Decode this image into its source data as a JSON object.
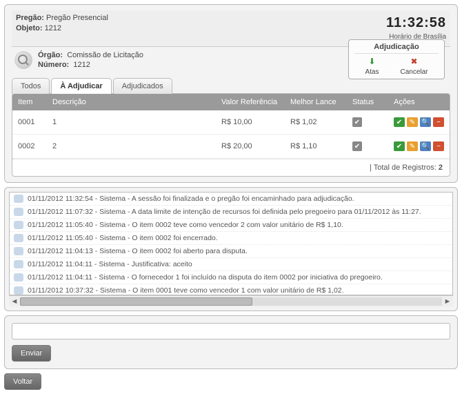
{
  "header": {
    "pregao_label": "Pregão:",
    "pregao_value": "Pregão Presencial",
    "objeto_label": "Objeto:",
    "objeto_value": "1212",
    "clock": "11:32:58",
    "clock_sub": "Horário de Brasília"
  },
  "info": {
    "orgao_label": "Órgão:",
    "orgao_value": "Comissão de Licitação",
    "numero_label": "Número:",
    "numero_value": "1212"
  },
  "actions_box": {
    "title": "Adjudicação",
    "atas": "Atas",
    "cancelar": "Cancelar"
  },
  "tabs": {
    "todos": "Todos",
    "adjudicar": "À Adjudicar",
    "adjudicados": "Adjudicados"
  },
  "table": {
    "headers": {
      "item": "Item",
      "descricao": "Descrição",
      "valor_ref": "Valor Referência",
      "melhor_lance": "Melhor Lance",
      "status": "Status",
      "acoes": "Ações"
    },
    "rows": [
      {
        "item": "0001",
        "descricao": "1",
        "valor_ref": "R$ 10,00",
        "melhor_lance": "R$ 1,02"
      },
      {
        "item": "0002",
        "descricao": "2",
        "valor_ref": "R$ 20,00",
        "melhor_lance": "R$ 1,10"
      }
    ],
    "footer_label": "| Total de Registros:",
    "footer_count": "2"
  },
  "log": [
    "01/11/2012 11:32:54 - Sistema - A sessão foi finalizada e o pregão foi encaminhado para adjudicação.",
    "01/11/2012 11:07:32 - Sistema - A data limite de intenção de recursos foi definida pelo pregoeiro para 01/11/2012 às 11:27.",
    "01/11/2012 11:05:40 - Sistema - O item 0002 teve como vencedor 2 com valor unitário de R$ 1,10.",
    "01/11/2012 11:05:40 - Sistema - O item 0002 foi encerrado.",
    "01/11/2012 11:04:13 - Sistema - O item 0002 foi aberto para disputa.",
    "01/11/2012 11:04:11 - Sistema - Justificativa: aceito",
    "01/11/2012 11:04:11 - Sistema - O fornecedor 1 foi incluído na disputa do item 0002 por iniciativa do pregoeiro.",
    "01/11/2012 10:37:32 - Sistema - O item 0001 teve como vencedor 1 com valor unitário de R$ 1,02."
  ],
  "buttons": {
    "enviar": "Enviar",
    "voltar": "Voltar"
  }
}
